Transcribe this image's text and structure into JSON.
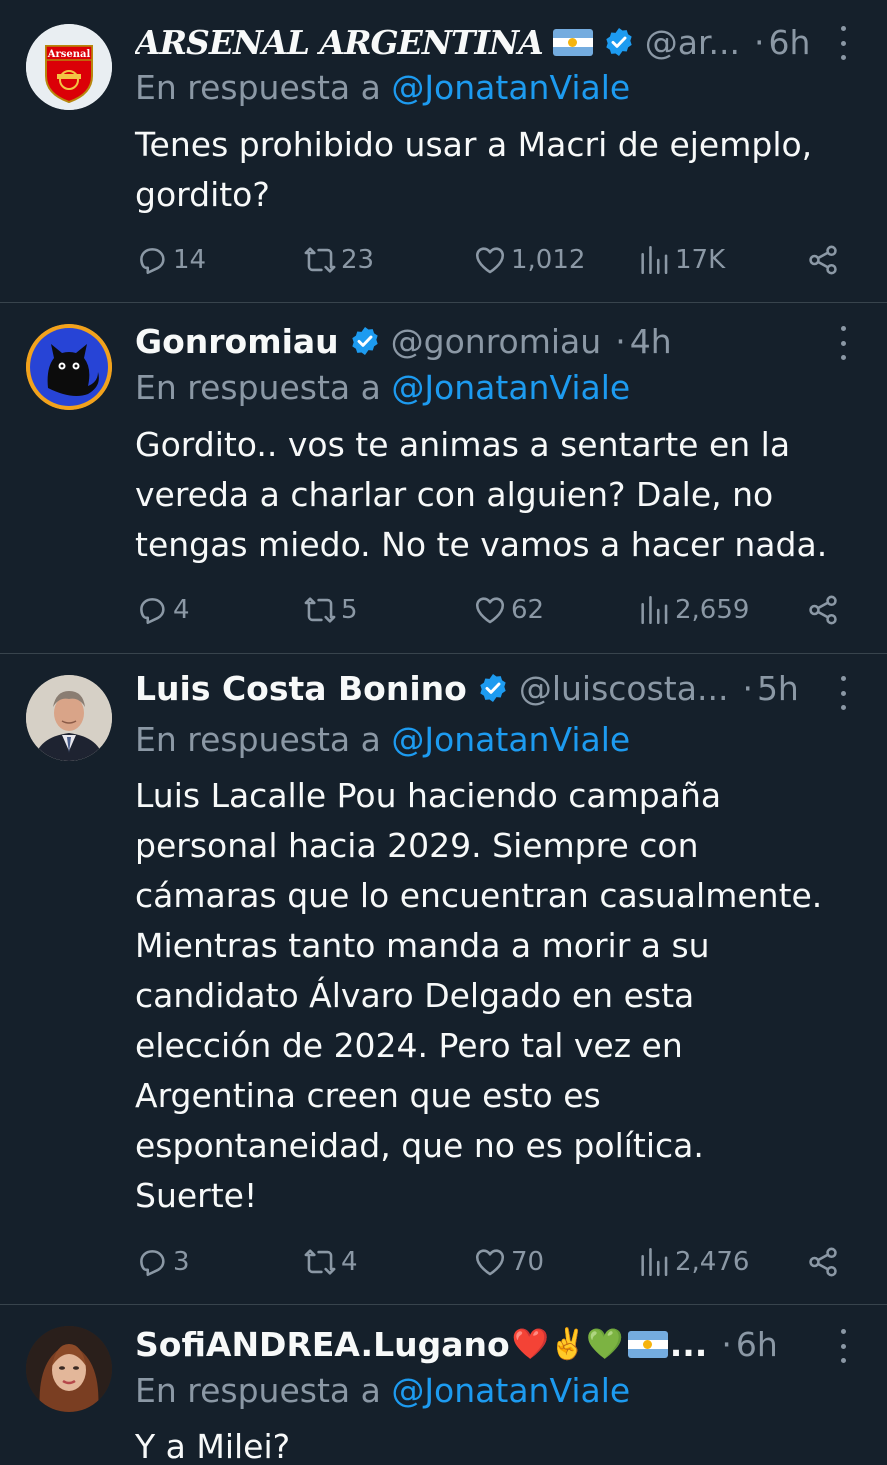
{
  "colors": {
    "background": "#15202b",
    "text": "#f7f9f9",
    "muted": "#8b98a5",
    "link": "#1d9bf0",
    "divider": "#38444d",
    "verified": "#1d9bf0"
  },
  "tweets": [
    {
      "name": "ARSENAL ARGENTINA",
      "handle": "@ar...",
      "dot": "·",
      "time": "6h",
      "reply_prefix": "En respuesta a ",
      "reply_to": "@JonatanViale",
      "text_lines": [
        "Tenes prohibido usar a Macri de ejemplo,",
        "gordito?"
      ],
      "replies": "14",
      "retweets": "23",
      "likes": "1,012",
      "views": "17K",
      "avatar_icon": "arsenal-crest-avatar",
      "avatar_label": "Arsenal"
    },
    {
      "name": "Gonromiau",
      "handle": "@gonromiau",
      "dot": "·",
      "time": "4h",
      "reply_prefix": "En respuesta a ",
      "reply_to": "@JonatanViale",
      "text_lines": [
        "Gordito.. vos te animas a sentarte en la",
        "vereda a charlar con alguien?  Dale, no",
        "tengas miedo. No te vamos a hacer nada."
      ],
      "replies": "4",
      "retweets": "5",
      "likes": "62",
      "views": "2,659",
      "avatar_icon": "black-cat-avatar"
    },
    {
      "name": "Luis Costa Bonino",
      "handle": "@luiscosta...",
      "dot": "·",
      "time": "5h",
      "reply_prefix": "En respuesta a ",
      "reply_to": "@JonatanViale",
      "text_lines": [
        "Luis Lacalle Pou haciendo campaña",
        "personal hacia 2029. Siempre con",
        "cámaras que lo encuentran casualmente.",
        "Mientras tanto manda a morir a su",
        "candidato Álvaro Delgado en esta",
        "elección de 2024. Pero tal vez en",
        "Argentina creen que esto es",
        "espontaneidad, que no es política.",
        "Suerte!"
      ],
      "replies": "3",
      "retweets": "4",
      "likes": "70",
      "views": "2,476",
      "avatar_icon": "man-in-suit-avatar"
    },
    {
      "name": "SofiANDREA.Lugano",
      "name_emoji": "❤️✌️💚",
      "name_tail": "...",
      "dot": "·",
      "time": "6h",
      "reply_prefix": "En respuesta a ",
      "reply_to": "@JonatanViale",
      "text_lines": [
        "Y a Milei?"
      ],
      "avatar_icon": "woman-portrait-avatar"
    }
  ]
}
